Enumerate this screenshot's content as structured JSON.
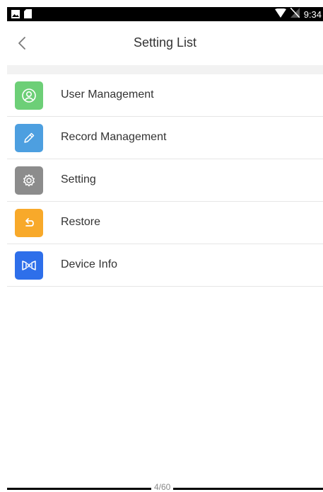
{
  "status_bar": {
    "time": "9:34",
    "icons": [
      "image-icon",
      "sd-card-icon",
      "wifi-icon",
      "no-sim-icon"
    ]
  },
  "header": {
    "title": "Setting List",
    "back_icon": "chevron-left-icon"
  },
  "menu": {
    "items": [
      {
        "label": "User Management",
        "icon": "user-icon",
        "color": "#6dcf77"
      },
      {
        "label": "Record Management",
        "icon": "pencil-icon",
        "color": "#4d9fe0"
      },
      {
        "label": "Setting",
        "icon": "gear-icon",
        "color": "#8c8c8c"
      },
      {
        "label": "Restore",
        "icon": "restore-icon",
        "color": "#f8a92a"
      },
      {
        "label": "Device Info",
        "icon": "device-info-icon",
        "color": "#2e6fea"
      }
    ]
  },
  "footer": {
    "page_number": "4/60"
  }
}
